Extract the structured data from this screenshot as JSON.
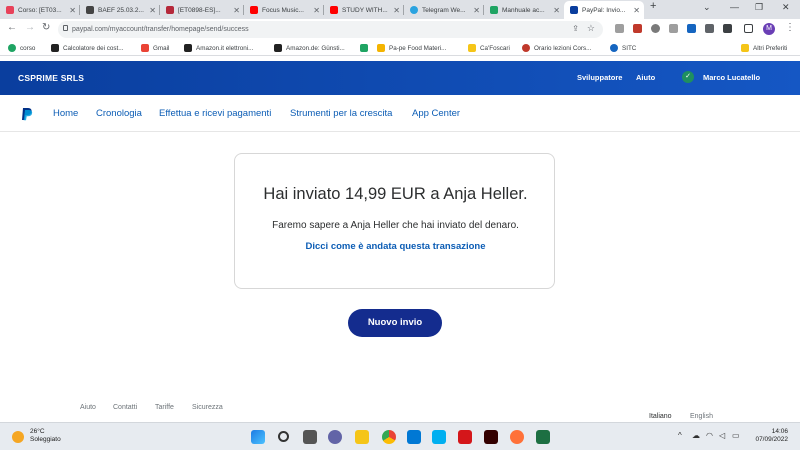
{
  "browser": {
    "tabs": [
      {
        "title": "Corso: [ET03...",
        "color": "#e8425a"
      },
      {
        "title": "BAEF 25.03.2...",
        "color": "#444444"
      },
      {
        "title": "[ET0898-ES]...",
        "color": "#b5283a"
      },
      {
        "title": "Focus Music...",
        "color": "#ff0000"
      },
      {
        "title": "STUDY WITH...",
        "color": "#ff0000"
      },
      {
        "title": "Telegram We...",
        "color": "#2aa3e0"
      },
      {
        "title": "Manhuale ac...",
        "color": "#1fa463"
      },
      {
        "title": "PayPal: Invio...",
        "color": "#0a3e9e"
      }
    ],
    "new_tab_label": "+",
    "url": "paypal.com/myaccount/transfer/homepage/send/success",
    "profile_initial": "M",
    "bookmarks": [
      {
        "label": "corso",
        "color": "#1fa463"
      },
      {
        "label": "Calcolatore dei cost...",
        "color": "#222222"
      },
      {
        "label": "Gmail",
        "color": "#ea4335"
      },
      {
        "label": "Amazon.it elettroni...",
        "color": "#222222"
      },
      {
        "label": "Amazon.de: Günsti...",
        "color": "#222222"
      },
      {
        "label": "",
        "color": "#1fa463"
      },
      {
        "label": "Pa-pe Food Materi...",
        "color": "#f4b400"
      },
      {
        "label": "Ca'Foscari",
        "color": "#f5c518"
      },
      {
        "label": "Orario lezioni Cors...",
        "color": "#c0392b"
      },
      {
        "label": "SITC",
        "color": "#1565c0"
      }
    ],
    "other_bookmarks": "Altri Preferiti"
  },
  "paypal": {
    "business_name": "CSPRIME SRLS",
    "developer_link": "Sviluppatore",
    "help_link": "Aiuto",
    "user_name": "Marco Lucatello",
    "nav": [
      "Home",
      "Cronologia",
      "Effettua e ricevi pagamenti",
      "Strumenti per la crescita",
      "App Center"
    ],
    "success": {
      "headline": "Hai inviato 14,99 EUR a Anja Heller.",
      "message": "Faremo sapere a Anja Heller che hai inviato del denaro.",
      "feedback_link": "Dicci come è andata questa transazione"
    },
    "new_send_button": "Nuovo invio",
    "footer_links": [
      "Aiuto",
      "Contatti",
      "Tariffe",
      "Sicurezza"
    ],
    "languages": [
      "Italiano",
      "English"
    ]
  },
  "taskbar": {
    "temperature": "26°C",
    "weather": "Soleggiato",
    "time": "14:06",
    "date": "07/09/2022"
  }
}
